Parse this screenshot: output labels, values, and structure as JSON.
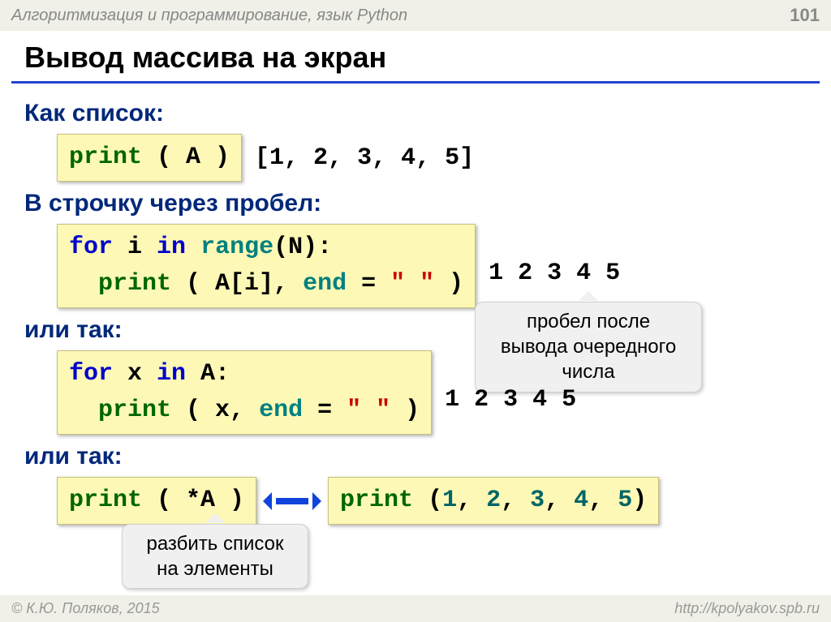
{
  "header": {
    "topic": "Алгоритмизация и программирование, язык Python",
    "page_number": "101"
  },
  "title": "Вывод массива на экран",
  "sec1": {
    "heading": "Как список:",
    "code_print": "print",
    "code_rest": " ( A )",
    "output": "[1, 2, 3, 4, 5]"
  },
  "sec2": {
    "heading": "В строчку через пробел:",
    "l1_for": "for",
    "l1_mid": " i ",
    "l1_in": "in",
    "l1_sp": " ",
    "l1_range": "range",
    "l1_tail": "(N):",
    "l2_indent": "  ",
    "l2_print": "print",
    "l2_mid": " ( A[i], ",
    "l2_end": "end",
    "l2_eq": " = ",
    "l2_str": "\" \"",
    "l2_close": " )",
    "output": "1 2 3 4 5",
    "callout": "пробел после\nвывода очередного\nчисла"
  },
  "sec3": {
    "heading": "или так:",
    "l1_for": "for",
    "l1_mid": " x ",
    "l1_in": "in",
    "l1_tail": " A:",
    "l2_indent": "  ",
    "l2_print": "print",
    "l2_mid": " ( x, ",
    "l2_end": "end",
    "l2_eq": " = ",
    "l2_str": "\" \"",
    "l2_close": " )",
    "output": "1 2 3 4 5"
  },
  "sec4": {
    "heading": "или так:"
  },
  "sec5": {
    "left_print": "print",
    "left_rest": " ( *A )",
    "right_print": "print",
    "right_paren1": " (",
    "n1": "1",
    "c1": ", ",
    "n2": "2",
    "c2": ", ",
    "n3": "3",
    "c3": ", ",
    "n4": "4",
    "c4": ", ",
    "n5": "5",
    "paren2": ")",
    "callout": "разбить список\nна элементы"
  },
  "footer": {
    "copyright": "© К.Ю. Поляков, 2015",
    "url": "http://kpolyakov.spb.ru"
  }
}
